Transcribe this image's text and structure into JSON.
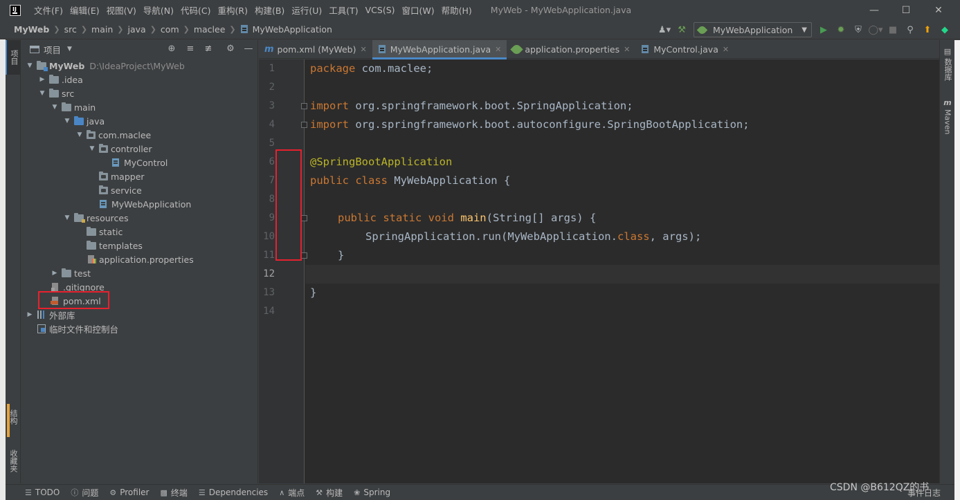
{
  "window": {
    "menu": [
      "文件(F)",
      "编辑(E)",
      "视图(V)",
      "导航(N)",
      "代码(C)",
      "重构(R)",
      "构建(B)",
      "运行(U)",
      "工具(T)",
      "VCS(S)",
      "窗口(W)",
      "帮助(H)"
    ],
    "title": "MyWeb - MyWebApplication.java"
  },
  "breadcrumb": [
    "MyWeb",
    "src",
    "main",
    "java",
    "com",
    "maclee",
    "MyWebApplication"
  ],
  "run_config": "MyWebApplication",
  "left_stripe": {
    "project": "项目",
    "structure": "结构",
    "favorites": "收藏夹"
  },
  "right_stripe": {
    "database": "数据库",
    "maven": "Maven"
  },
  "project_panel": {
    "title": "项目",
    "root_name": "MyWeb",
    "root_path": "D:\\IdeaProject\\MyWeb",
    "items": [
      "MyWeb",
      ".idea",
      "src",
      "main",
      "java",
      "com.maclee",
      "controller",
      "MyControl",
      "mapper",
      "service",
      "MyWebApplication",
      "resources",
      "static",
      "templates",
      "application.properties",
      "test",
      ".gitignore",
      "pom.xml",
      "外部库",
      "临时文件和控制台"
    ]
  },
  "tabs": [
    {
      "label": "pom.xml (MyWeb)"
    },
    {
      "label": "MyWebApplication.java"
    },
    {
      "label": "application.properties"
    },
    {
      "label": "MyControl.java"
    }
  ],
  "editor": {
    "line_numbers": [
      "1",
      "2",
      "3",
      "4",
      "5",
      "6",
      "7",
      "8",
      "9",
      "10",
      "11",
      "12",
      "13",
      "14"
    ],
    "code": {
      "l1_kw": "package",
      "l1_rest": " com.maclee;",
      "l3_kw": "import",
      "l3_rest": " org.springframework.boot.SpringApplication;",
      "l4_kw": "import",
      "l4_rest": " org.springframework.boot.autoconfigure.SpringBootApplication;",
      "l6_ann": "@SpringBootApplication",
      "l7_kw": "public class",
      "l7_rest": " MyWebApplication {",
      "l9_kw": "public static void",
      "l9_fn": " main",
      "l9_rest": "(String[] args) {",
      "l10_a": "SpringApplication.",
      "l10_fn": "run",
      "l10_b": "(MyWebApplication.",
      "l10_kw": "class",
      "l10_c": ", args);",
      "l11": "}",
      "l13": "}"
    }
  },
  "bottom_bar": [
    "TODO",
    "问题",
    "Profiler",
    "终端",
    "Dependencies",
    "端点",
    "构建",
    "Spring"
  ],
  "event_log": "事件日志",
  "watermark": "CSDN @B612QZ的书"
}
